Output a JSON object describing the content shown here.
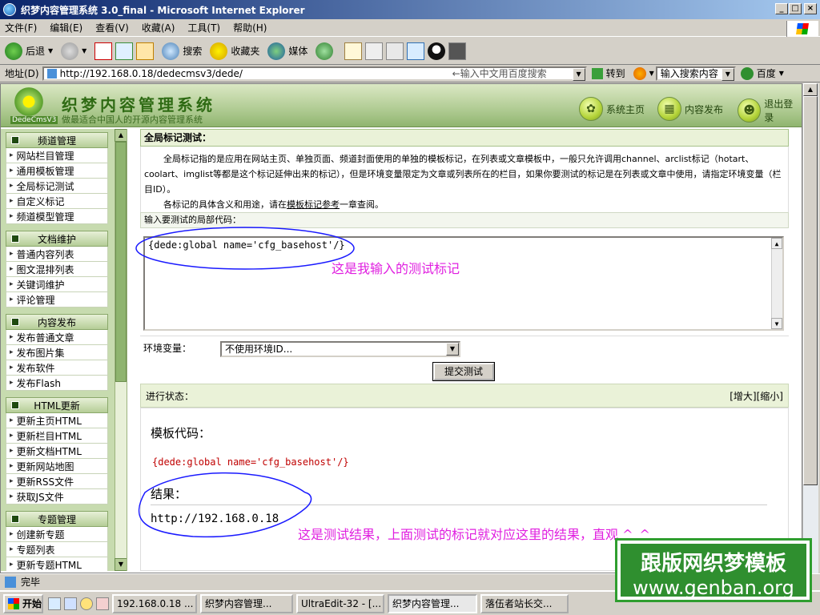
{
  "window": {
    "title": "织梦内容管理系统 3.0_final - Microsoft Internet Explorer"
  },
  "menu": [
    "文件(F)",
    "编辑(E)",
    "查看(V)",
    "收藏(A)",
    "工具(T)",
    "帮助(H)"
  ],
  "toolbar": {
    "back": "后退",
    "search": "搜索",
    "favorites": "收藏夹",
    "media": "媒体"
  },
  "address": {
    "label": "地址(D)",
    "url": "http://192.168.0.18/dedecmsv3/dede/",
    "baidu_hint": "←输入中文用百度搜索",
    "go": "转到",
    "search_mode": "输入搜索内容",
    "baidu": "百度"
  },
  "dede": {
    "logo_tag": "DedeCmsV3",
    "title": "织梦内容管理系统",
    "slogan": "做最适合中国人的开源内容管理系统",
    "nav": [
      "系统主页",
      "内容发布",
      "退出登录"
    ]
  },
  "sidebar": {
    "groups": [
      {
        "title": "频道管理",
        "items": [
          "网站栏目管理",
          "通用模板管理",
          "全局标记测试",
          "自定义标记",
          "频道模型管理"
        ]
      },
      {
        "title": "文档维护",
        "items": [
          "普通内容列表",
          "图文混排列表",
          "关键词维护",
          "评论管理"
        ]
      },
      {
        "title": "内容发布",
        "items": [
          "发布普通文章",
          "发布图片集",
          "发布软件",
          "发布Flash"
        ]
      },
      {
        "title": "HTML更新",
        "items": [
          "更新主页HTML",
          "更新栏目HTML",
          "更新文档HTML",
          "更新网站地图",
          "更新RSS文件",
          "获取JS文件"
        ]
      },
      {
        "title": "专题管理",
        "items": [
          "创建新专题",
          "专题列表",
          "更新专题HTML"
        ]
      }
    ]
  },
  "main": {
    "title": "全局标记测试：",
    "desc1": "全局标记指的是应用在网站主页、单独页面、频道封面使用的单独的模板标记，在列表或文章模板中，一般只允许调用channel、arclist标记（hotart、coolart、imglist等都是这个标记延伸出来的标记），但是环境变量限定为文章或列表所在的栏目，如果你要测试的标记是在列表或文章中使用，请指定环境变量（栏目ID）。",
    "desc2_pre": "各标记的具体含义和用途，请在",
    "desc2_link": "模板标记参考",
    "desc2_post": "一章查阅。",
    "input_label": "输入要测试的局部代码：",
    "code": "{dede:global name='cfg_basehost'/}",
    "env_label": "环境变量：",
    "env_value": "不使用环境ID...",
    "submit": "提交测试",
    "progress_label": "进行状态：",
    "zoom_in": "[增大]",
    "zoom_out": "[缩小]",
    "tpl_label": "模板代码：",
    "tpl_code": "{dede:global name='cfg_basehost'/}",
    "result_label": "结果：",
    "result_value": "http://192.168.0.18"
  },
  "annotations": {
    "a1": "这是我输入的测试标记",
    "a2": "这是测试结果，上面测试的标记就对应这里的结果，直观 ^_^"
  },
  "status": {
    "text": "完毕"
  },
  "taskbar": {
    "start": "开始",
    "tasks": [
      "192.168.0.18 ...",
      "织梦内容管理...",
      "UltraEdit-32 - [...",
      "织梦内容管理...",
      "落伍者站长交..."
    ]
  },
  "watermark": {
    "line1": "跟版网织梦模板",
    "line2": "www.genban.org"
  }
}
